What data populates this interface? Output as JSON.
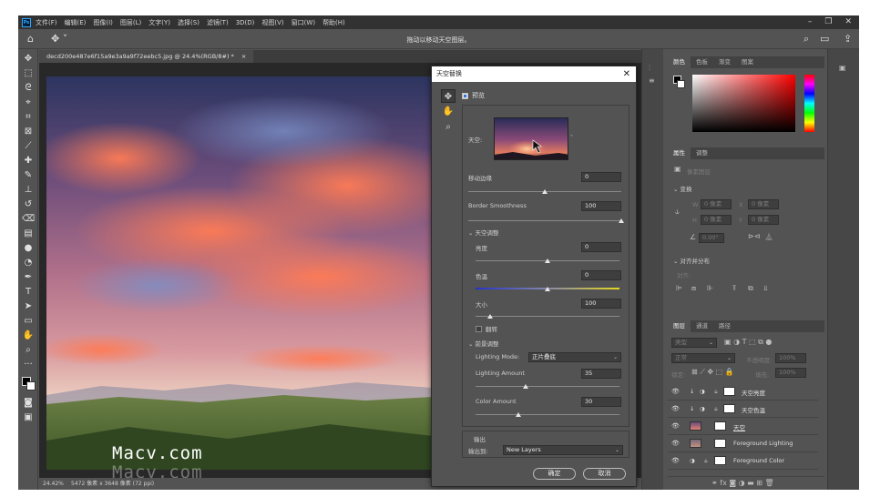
{
  "menubar": {
    "logo": "Ps",
    "items": [
      "文件(F)",
      "编辑(E)",
      "图像(I)",
      "图层(L)",
      "文字(Y)",
      "选择(S)",
      "滤镜(T)",
      "3D(D)",
      "视图(V)",
      "窗口(W)",
      "帮助(H)"
    ]
  },
  "optionsbar": {
    "hint": "拖动以移动天空图层。"
  },
  "document": {
    "tab_title": "decd200e487e6f15a9e3a9a9f72eebc5.jpg @ 24.4%(RGB/8#) *",
    "zoom": "24.42%",
    "dimensions": "5472 像素 x 3648 像素 (72 ppi)"
  },
  "watermark": "Macv.com",
  "dialog": {
    "title": "天空替换",
    "preview_label": "预览",
    "preview_checked": true,
    "sky_label": "天空:",
    "shift_edge_label": "移动边缘",
    "shift_edge_value": "0",
    "shift_edge_level": 0.5,
    "border_smoothness_label": "Border Smoothness",
    "border_smoothness_value": "100",
    "border_smoothness_level": 1.0,
    "sky_adjust_header": "天空调整",
    "brightness_label": "亮度",
    "brightness_value": "0",
    "brightness_level": 0.5,
    "temperature_label": "色温",
    "temperature_value": "0",
    "temperature_level": 0.5,
    "scale_label": "大小",
    "scale_value": "100",
    "scale_level": 0.1,
    "flip_label": "翻转",
    "flip_checked": false,
    "foreground_header": "前景调整",
    "lighting_mode_label": "Lighting Mode:",
    "lighting_mode_value": "正片叠底",
    "lighting_amount_label": "Lighting Amount",
    "lighting_amount_value": "35",
    "lighting_amount_level": 0.35,
    "color_amount_label": "Color Amount",
    "color_amount_value": "30",
    "color_amount_level": 0.3,
    "output_header": "输出",
    "output_to_label": "输出到:",
    "output_to_value": "New Layers",
    "ok_label": "确定",
    "cancel_label": "取消"
  },
  "color_panel": {
    "tabs": [
      "颜色",
      "色板",
      "渐变",
      "图案"
    ]
  },
  "properties_panel": {
    "tabs": [
      "属性",
      "调整"
    ],
    "layer_type": "像素图层",
    "transform_header": "变换",
    "w_label": "W",
    "h_label": "H",
    "x_label": "X",
    "y_label": "Y",
    "placeholder_px": "0 像素",
    "angle": "0.00°",
    "align_header": "对齐并分布",
    "align_label": "对齐:"
  },
  "layers_panel": {
    "tabs": [
      "图层",
      "通道",
      "路径"
    ],
    "filter_placeholder": "类型",
    "blend_mode": "正常",
    "opacity_label": "不透明度:",
    "opacity_value": "100%",
    "lock_label": "锁定:",
    "fill_label": "填充:",
    "fill_value": "100%",
    "layers": [
      {
        "name": "天空亮度"
      },
      {
        "name": "天空色温"
      },
      {
        "name": "天空"
      },
      {
        "name": "Foreground Lighting"
      },
      {
        "name": "Foreground Color"
      }
    ]
  },
  "colors": {
    "app_bg": "#535353",
    "menubar": "#323232",
    "canvas_bg": "#282828"
  }
}
